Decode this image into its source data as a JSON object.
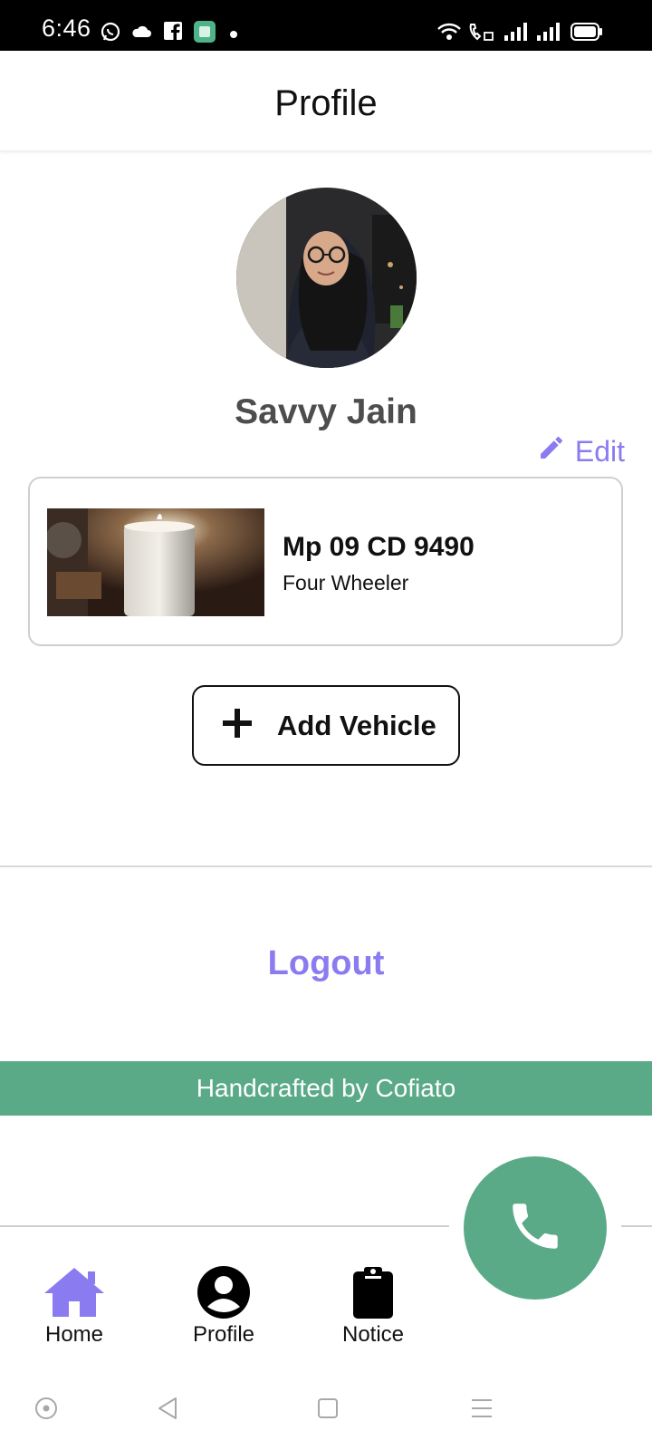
{
  "status_bar": {
    "time": "6:46",
    "icons_left": [
      "whatsapp-icon",
      "cloud-icon",
      "facebook-icon",
      "app-icon",
      "dot-icon"
    ],
    "icons_right": [
      "wifi-icon",
      "call-icon",
      "signal-icon",
      "signal-icon",
      "battery-icon"
    ]
  },
  "header": {
    "title": "Profile"
  },
  "profile": {
    "name": "Savvy Jain",
    "edit_label": "Edit"
  },
  "vehicle": {
    "plate": "Mp 09 CD 9490",
    "type": "Four Wheeler"
  },
  "add_vehicle": {
    "label": "Add Vehicle"
  },
  "logout": {
    "label": "Logout"
  },
  "footer": {
    "text": "Handcrafted by Cofiato"
  },
  "bottom_nav": {
    "items": [
      {
        "label": "Home",
        "icon": "home-icon"
      },
      {
        "label": "Profile",
        "icon": "account-circle-icon"
      },
      {
        "label": "Notice",
        "icon": "clipboard-icon"
      }
    ]
  },
  "colors": {
    "accent": "#8a7cf0",
    "green": "#5aaa88",
    "name_gray": "#4d4d4d"
  }
}
